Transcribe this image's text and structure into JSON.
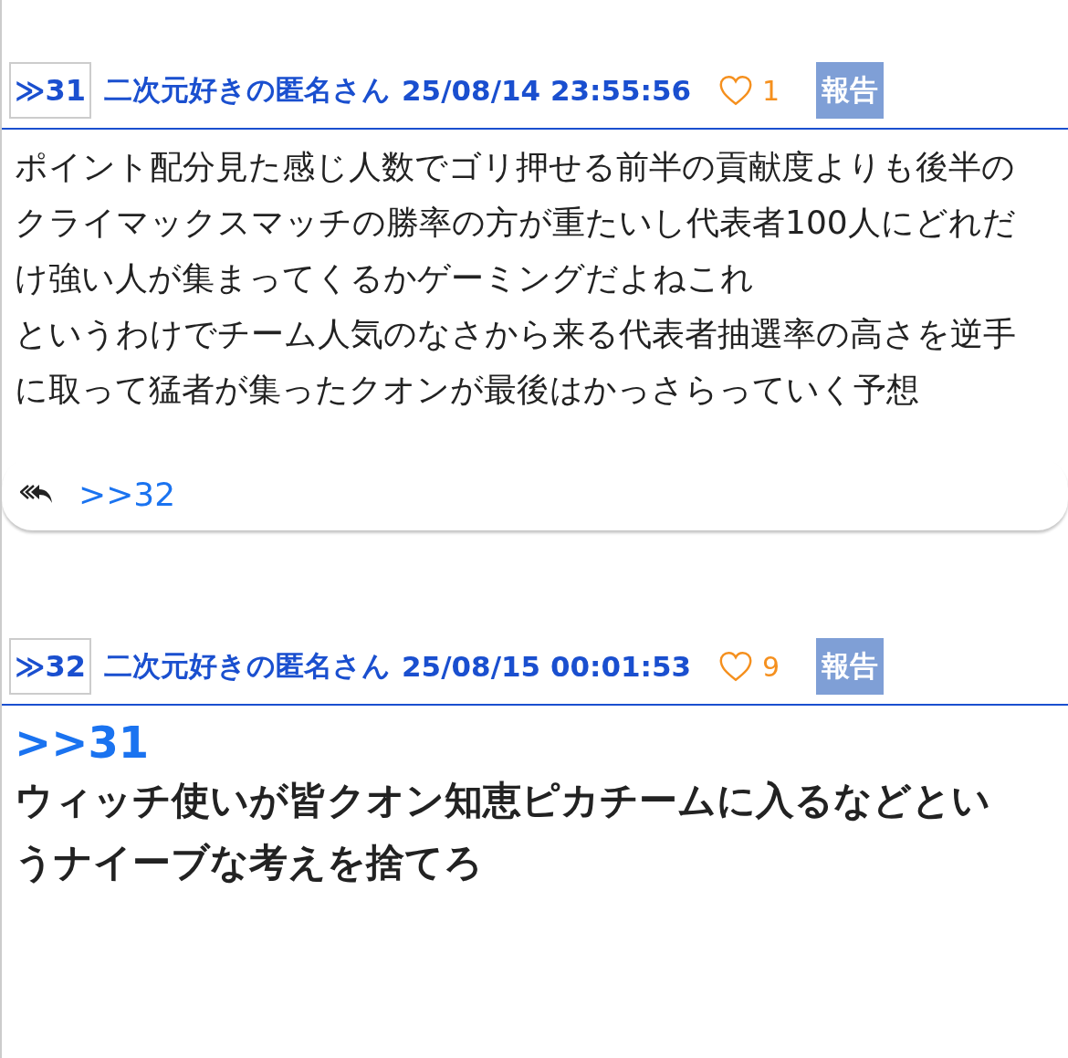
{
  "posts": [
    {
      "number": "≫31",
      "name": "二次元好きの匿名さん",
      "date": "25/08/14 23:55:56",
      "likes": "1",
      "report": "報告",
      "body": [
        {
          "kind": "text",
          "text": "ポイント配分見た感じ人数でゴリ押せる前半の貢献度よりも後半のクライマックスマッチの勝率の方が重たいし代表者100人にどれだけ強い人が集まってくるかゲーミングだよねこれ"
        },
        {
          "kind": "text",
          "text": "というわけでチーム人気のなさから来る代表者抽選率の高さを逆手に取って猛者が集ったクオンが最後はかっさらっていく予想"
        }
      ],
      "replies": [
        ">>32"
      ]
    },
    {
      "number": "≫32",
      "name": "二次元好きの匿名さん",
      "date": "25/08/15 00:01:53",
      "likes": "9",
      "report": "報告",
      "body": [
        {
          "kind": "anchor",
          "text": ">>31"
        },
        {
          "kind": "bold",
          "text": "ウィッチ使いが皆クオン知恵ピカチームに入るなどというナイーブな考えを捨てろ"
        }
      ]
    }
  ]
}
